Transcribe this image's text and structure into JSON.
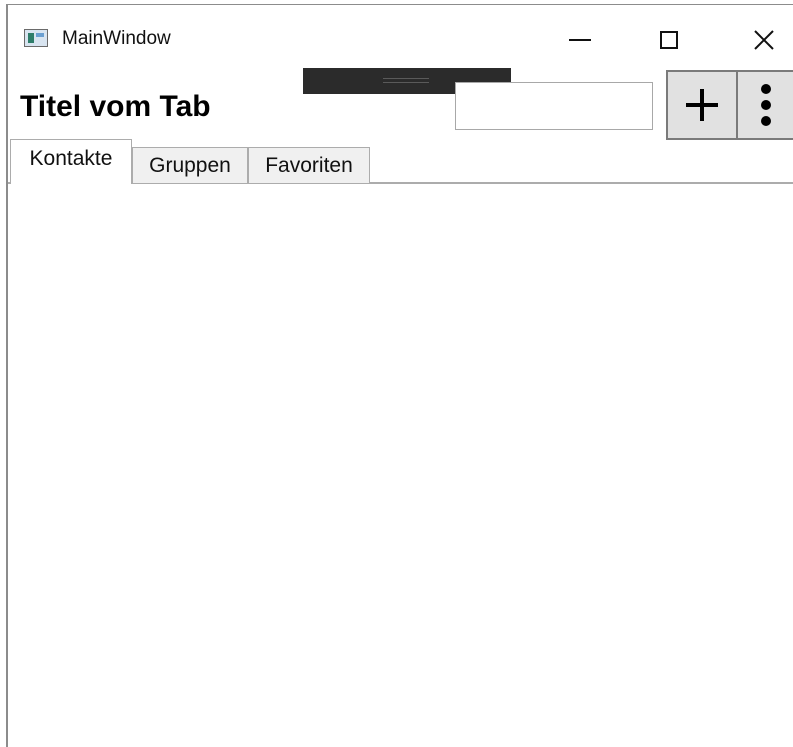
{
  "window": {
    "title": "MainWindow",
    "icon": "app-window-icon",
    "controls": {
      "minimize_icon": "minimize-icon",
      "maximize_icon": "maximize-icon",
      "close_icon": "close-icon"
    }
  },
  "header": {
    "title": "Titel vom Tab",
    "search": {
      "value": "",
      "placeholder": ""
    },
    "add_button_icon": "plus-icon",
    "more_button_icon": "vertical-ellipsis-icon"
  },
  "tabs": [
    {
      "label": "Kontakte",
      "active": true
    },
    {
      "label": "Gruppen",
      "active": false
    },
    {
      "label": "Favoriten",
      "active": false
    }
  ],
  "colors": {
    "drag_bar": "#2b2b2b",
    "button_background": "#e1e1e1",
    "tab_background": "#f0f0f0"
  }
}
